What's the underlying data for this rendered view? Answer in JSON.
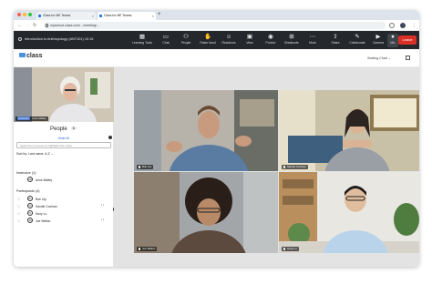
{
  "browser": {
    "tabs": [
      {
        "title": "Class for ME Teams"
      },
      {
        "title": "Class for ME Teams"
      }
    ],
    "url": "myschool.class.com/.../meeting/...",
    "new_tab_symbol": "+"
  },
  "toolbar": {
    "course_title": "Introduction to Anthropology (ANT101) 10:15",
    "items": [
      {
        "label": "Learning Tools",
        "icon": "learning-tools-icon"
      },
      {
        "label": "Chat",
        "icon": "chat-icon"
      },
      {
        "label": "People",
        "icon": "people-icon"
      },
      {
        "label": "Raise hand",
        "icon": "raise-hand-icon"
      },
      {
        "label": "Reactions",
        "icon": "reactions-icon"
      },
      {
        "label": "View",
        "icon": "view-icon"
      },
      {
        "label": "Proctor",
        "icon": "proctor-icon"
      },
      {
        "label": "Breakouts",
        "icon": "breakouts-icon"
      },
      {
        "label": "More",
        "icon": "more-icon"
      },
      {
        "label": "Share",
        "icon": "share-icon"
      },
      {
        "label": "Collaborate",
        "icon": "collaborate-icon"
      },
      {
        "label": "Camera",
        "icon": "camera-icon"
      },
      {
        "label": "Mic",
        "icon": "mic-icon"
      }
    ],
    "leave_label": "Leave"
  },
  "subheader": {
    "logo_text": "class",
    "seating_label": "Seating Chart"
  },
  "sidebar": {
    "self_name": "Anne Malley",
    "self_tag": "Instructor",
    "people_title": "People",
    "people_count": "6",
    "mute_all": "Mute All",
    "search_placeholder": "Search for someone to highlight their video",
    "sort_prefix": "Sort by:",
    "sort_value": "Last name, A-Z",
    "instructor_header": "Instructor (1)",
    "instructors": [
      {
        "initials": "AM",
        "name": "Anne Malley"
      }
    ],
    "participants_header": "Participants (4)",
    "participants": [
      {
        "initials": "BL",
        "name": "Bob Lily"
      },
      {
        "initials": "SC",
        "name": "Sandie Cochran"
      },
      {
        "initials": "HL",
        "name": "Huey Lu"
      },
      {
        "initials": "JW",
        "name": "Joe Walton"
      }
    ]
  },
  "videos": [
    {
      "name": "Bob Lily"
    },
    {
      "name": "Sandie Cochran"
    },
    {
      "name": "Joe Walton"
    },
    {
      "name": "Huey Lu"
    }
  ],
  "colors": {
    "toolbar_bg": "#24282d",
    "leave_bg": "#d93025",
    "link_blue": "#2d6cd1",
    "stage_bg": "#e3e3e3"
  }
}
